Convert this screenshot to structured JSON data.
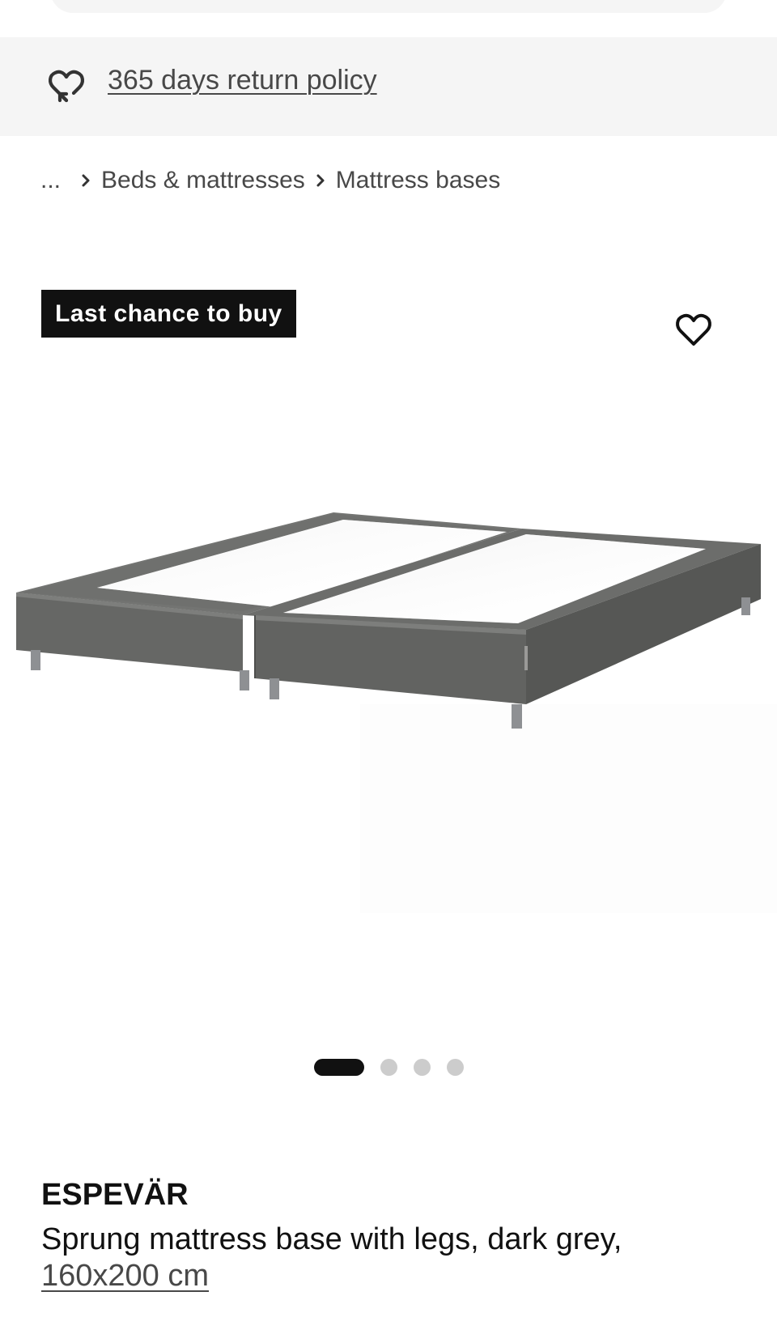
{
  "return_banner": {
    "icon": "return-heart-icon",
    "link_text": "365 days return policy"
  },
  "breadcrumb": {
    "ellipsis": "...",
    "items": [
      "Beds & mattresses",
      "Mattress bases"
    ]
  },
  "badge": {
    "label": "Last chance to buy"
  },
  "favorite": {
    "icon": "heart-outline-icon"
  },
  "carousel": {
    "total": 4,
    "active_index": 0
  },
  "product": {
    "name": "ESPEVÄR",
    "description": "Sprung mattress base with legs, dark grey,",
    "size": "160x200 cm"
  },
  "colors": {
    "banner_bg": "#f5f5f5",
    "badge_bg": "#111111",
    "badge_text": "#ffffff",
    "link_text": "#484848",
    "dot_inactive": "#cccccc",
    "dot_active": "#111111",
    "base_fabric": "#6a6b69"
  }
}
